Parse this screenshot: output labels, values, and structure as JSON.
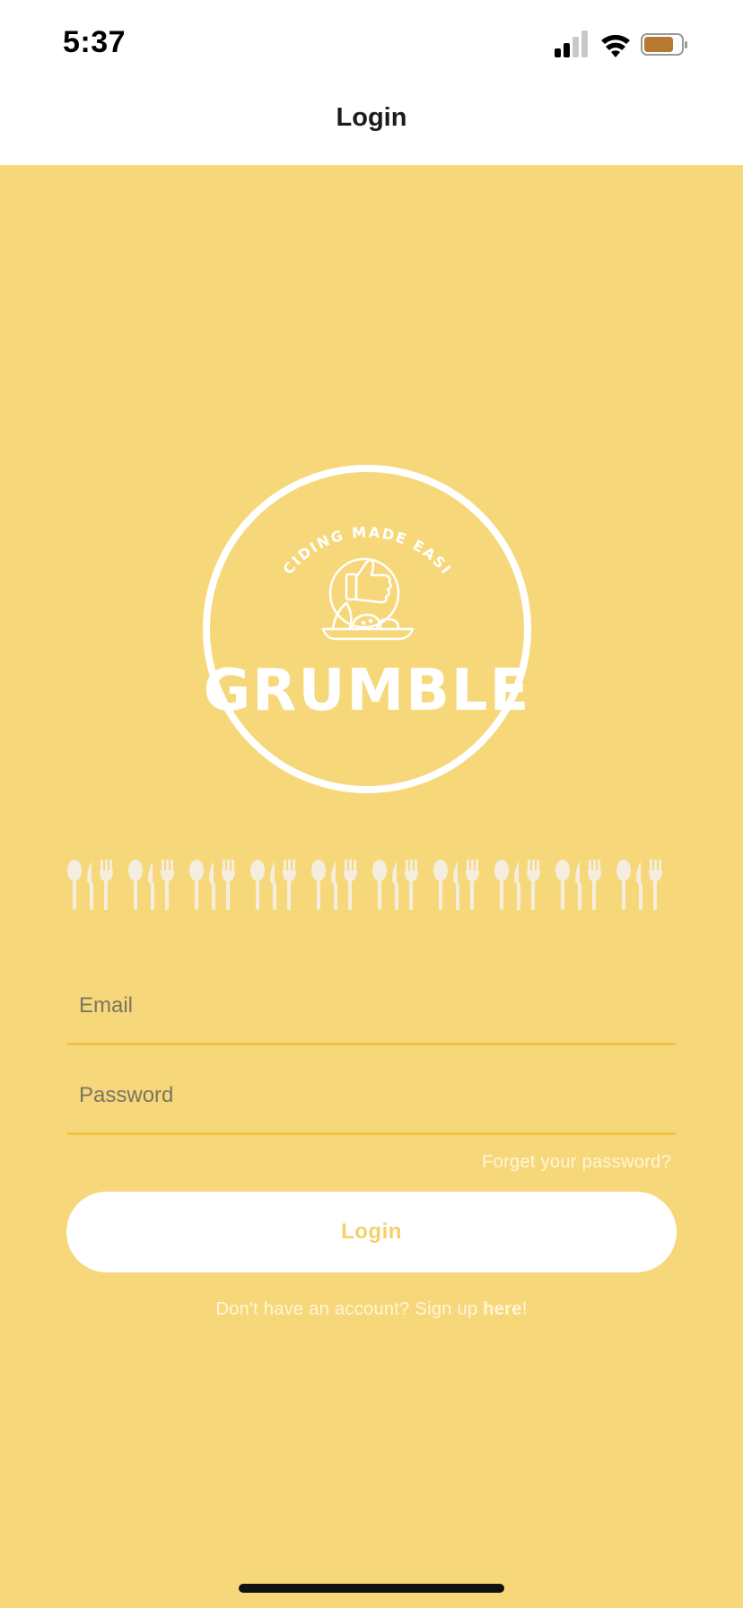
{
  "status_bar": {
    "time": "5:37",
    "icons": [
      "signal-icon",
      "wifi-icon",
      "battery-icon"
    ],
    "battery_color": "#B5792F"
  },
  "nav": {
    "title": "Login"
  },
  "logo": {
    "tagline": "DECIDING MADE EASIER",
    "brand": "GRUMBLE",
    "icon": "thumbs-up-food-plate-icon"
  },
  "decoration": {
    "icon": "cutlery-row-icon"
  },
  "form": {
    "email_placeholder": "Email",
    "email_value": "",
    "password_placeholder": "Password",
    "password_value": "",
    "forgot_label": "Forget your password?",
    "login_label": "Login",
    "signup_prefix": "Don't have an account? Sign up ",
    "signup_link": "here",
    "signup_suffix": "!"
  },
  "colors": {
    "background": "#F6D87A",
    "accent": "#F2C244",
    "button_text": "#F4D168"
  }
}
